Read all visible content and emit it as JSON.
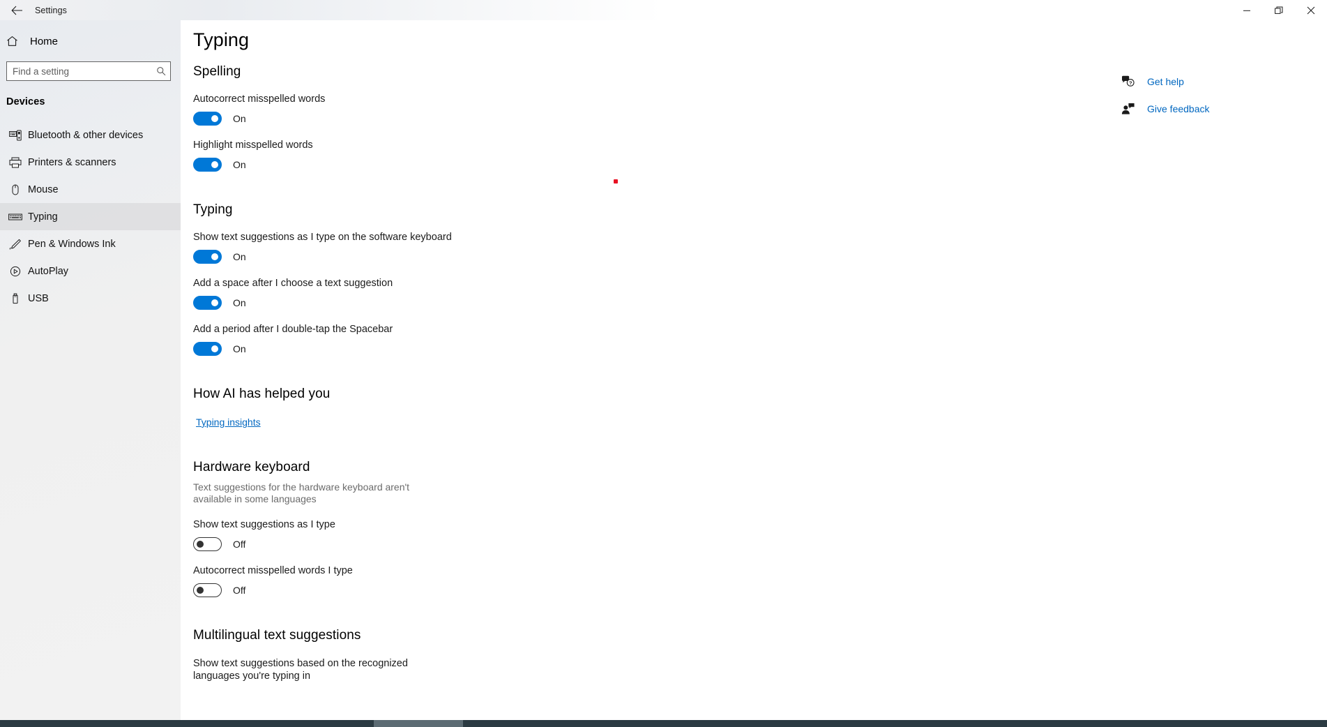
{
  "window": {
    "title": "Settings",
    "back_icon": "back-arrow-icon",
    "minimize_label": "Minimize",
    "restore_label": "Restore",
    "close_label": "Close"
  },
  "sidebar": {
    "home_label": "Home",
    "home_icon": "home-icon",
    "search": {
      "placeholder": "Find a setting",
      "value": "",
      "icon": "search-icon"
    },
    "category_title": "Devices",
    "items": [
      {
        "label": "Bluetooth & other devices",
        "icon": "bluetooth-devices-icon",
        "selected": false
      },
      {
        "label": "Printers & scanners",
        "icon": "printer-icon",
        "selected": false
      },
      {
        "label": "Mouse",
        "icon": "mouse-icon",
        "selected": false
      },
      {
        "label": "Typing",
        "icon": "keyboard-icon",
        "selected": true
      },
      {
        "label": "Pen & Windows Ink",
        "icon": "pen-icon",
        "selected": false
      },
      {
        "label": "AutoPlay",
        "icon": "autoplay-icon",
        "selected": false
      },
      {
        "label": "USB",
        "icon": "usb-icon",
        "selected": false
      }
    ]
  },
  "main": {
    "page_title": "Typing",
    "sections": {
      "spelling": {
        "heading": "Spelling",
        "settings": [
          {
            "label": "Autocorrect misspelled words",
            "state": "On",
            "on": true
          },
          {
            "label": "Highlight misspelled words",
            "state": "On",
            "on": true
          }
        ]
      },
      "typing": {
        "heading": "Typing",
        "settings": [
          {
            "label": "Show text suggestions as I type on the software keyboard",
            "state": "On",
            "on": true
          },
          {
            "label": "Add a space after I choose a text suggestion",
            "state": "On",
            "on": true
          },
          {
            "label": "Add a period after I double-tap the Spacebar",
            "state": "On",
            "on": true
          }
        ]
      },
      "ai": {
        "heading": "How AI has helped you",
        "link_label": "Typing insights"
      },
      "hardware": {
        "heading": "Hardware keyboard",
        "description": "Text suggestions for the hardware keyboard aren't available in some languages",
        "settings": [
          {
            "label": "Show text suggestions as I type",
            "state": "Off",
            "on": false
          },
          {
            "label": "Autocorrect misspelled words I type",
            "state": "Off",
            "on": false
          }
        ]
      },
      "multilingual": {
        "heading": "Multilingual text suggestions",
        "description": "Show text suggestions based on the recognized languages you're typing in"
      }
    }
  },
  "help": {
    "items": [
      {
        "label": "Get help",
        "icon": "question-bubble-icon"
      },
      {
        "label": "Give feedback",
        "icon": "feedback-person-icon"
      }
    ]
  },
  "colors": {
    "accent": "#0078d7",
    "link": "#0067c0",
    "marker": "#e81123"
  }
}
